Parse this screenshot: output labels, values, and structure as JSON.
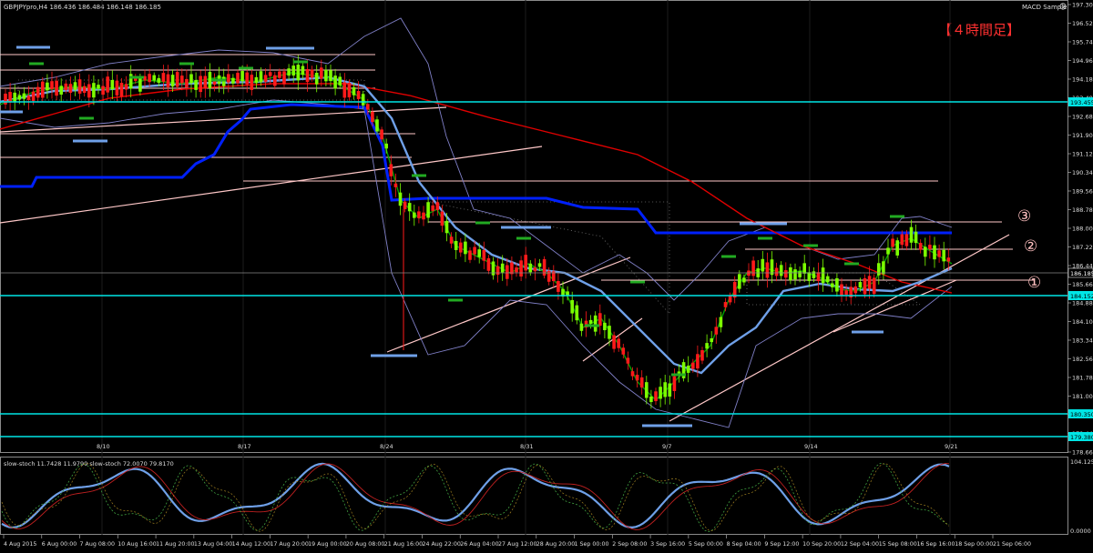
{
  "header": {
    "symbol_line": "GBPJPYpro,H4  186.436 186.484 186.148 186.185",
    "indicator_name": "MACD Sample",
    "timeframe_label": "【４時間足】"
  },
  "annotations": [
    "①",
    "②",
    "③"
  ],
  "stoch": {
    "label": "slow-stoch 11.7428 11.9799  slow-stoch 72.0070 79.8170",
    "y_top": "104.1254",
    "y_bottom": "0.0000"
  },
  "price_axis": [
    "197.30",
    "196.520",
    "195.740",
    "194.960",
    "194.180",
    "193.400",
    "192.680",
    "191.900",
    "191.120",
    "190.340",
    "189.560",
    "188.780",
    "188.000",
    "187.220",
    "186.440",
    "185.660",
    "184.880",
    "184.100",
    "183.340",
    "182.560",
    "181.780",
    "181.000",
    "180.220",
    "179.440",
    "178.660"
  ],
  "axis_badges": {
    "last_price": "186.185",
    "cyan_1": "193.455",
    "cyan_2": "184.152",
    "cyan_3": "180.350",
    "cyan_4": "179.380"
  },
  "date_markers": [
    "8/10",
    "8/17",
    "8/24",
    "8/31",
    "9/7",
    "9/14",
    "9/21"
  ],
  "time_axis": [
    "4 Aug 2015",
    "6 Aug 00:00",
    "7 Aug 08:00",
    "10 Aug 16:00",
    "11 Aug 20:00",
    "13 Aug 04:00",
    "14 Aug 12:00",
    "17 Aug 20:00",
    "19 Aug 00:00",
    "20 Aug 08:00",
    "21 Aug 16:00",
    "24 Aug 22:00",
    "26 Aug 04:00",
    "27 Aug 12:00",
    "28 Aug 20:00",
    "1 Sep 00:00",
    "2 Sep 08:00",
    "3 Sep 16:00",
    "5 Sep 00:00",
    "8 Sep 04:00",
    "9 Sep 12:00",
    "10 Sep 20:00",
    "12 Sep 04:00",
    "15 Sep 08:00",
    "16 Sep 16:00",
    "18 Sep 00:00",
    "21 Sep 06:00"
  ],
  "colors": {
    "background": "#000000",
    "bull_candle": "#7CFC00",
    "bear_candle": "#FF1A1A",
    "ma_red": "#E00000",
    "ma_green": "#00A000",
    "ma_blue": "#6FA0E8",
    "bands": "#8080C8",
    "kijun": "#0020FF",
    "cyan": "#00E5E5",
    "pink": "#FFC8C8",
    "title_red": "#FF3030"
  }
}
